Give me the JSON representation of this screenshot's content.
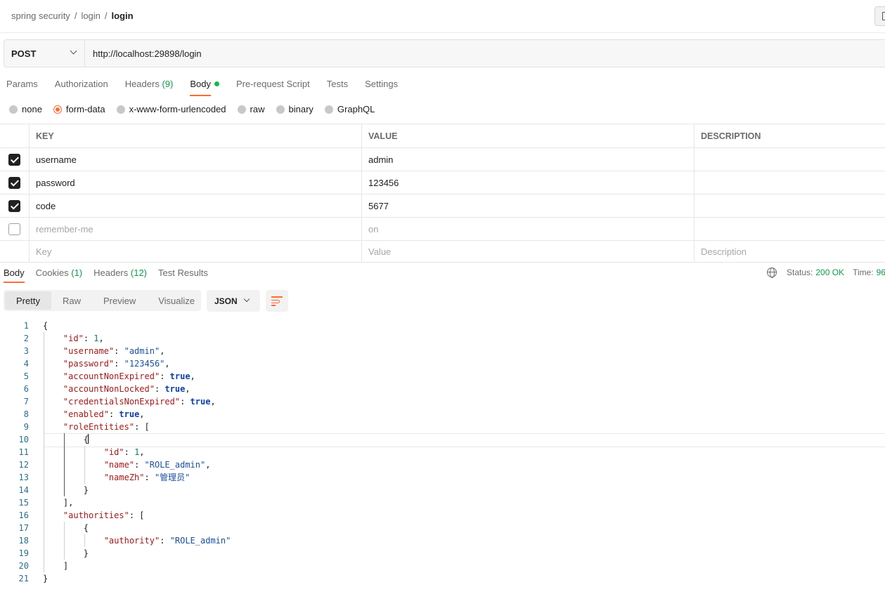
{
  "breadcrumb": {
    "items": [
      "spring security",
      "login"
    ],
    "current": "login"
  },
  "request": {
    "method": "POST",
    "url": "http://localhost:29898/login"
  },
  "request_tabs": [
    {
      "label": "Params"
    },
    {
      "label": "Authorization"
    },
    {
      "label": "Headers",
      "count": "(9)"
    },
    {
      "label": "Body",
      "active": true
    },
    {
      "label": "Pre-request Script"
    },
    {
      "label": "Tests"
    },
    {
      "label": "Settings"
    }
  ],
  "body_types": {
    "options": [
      "none",
      "form-data",
      "x-www-form-urlencoded",
      "raw",
      "binary",
      "GraphQL"
    ],
    "selected": "form-data"
  },
  "params_table": {
    "headers": {
      "key": "KEY",
      "value": "VALUE",
      "description": "DESCRIPTION"
    },
    "rows": [
      {
        "checked": true,
        "key": "username",
        "value": "admin"
      },
      {
        "checked": true,
        "key": "password",
        "value": "123456"
      },
      {
        "checked": true,
        "key": "code",
        "value": "5677"
      },
      {
        "checked": false,
        "key": "remember-me",
        "value": "on"
      }
    ],
    "placeholders": {
      "key": "Key",
      "value": "Value",
      "description": "Description"
    }
  },
  "response_tabs": [
    {
      "label": "Body",
      "active": true
    },
    {
      "label": "Cookies",
      "count": "(1)"
    },
    {
      "label": "Headers",
      "count": "(12)"
    },
    {
      "label": "Test Results"
    }
  ],
  "response_status": {
    "status_label": "Status:",
    "status_value": "200 OK",
    "time_label": "Time:",
    "time_value": "96"
  },
  "view_modes": {
    "options": [
      "Pretty",
      "Raw",
      "Preview",
      "Visualize"
    ],
    "selected": "Pretty"
  },
  "format": "JSON",
  "code_lines": [
    "{",
    "    \"id\": 1,",
    "    \"username\": \"admin\",",
    "    \"password\": \"123456\",",
    "    \"accountNonExpired\": true,",
    "    \"accountNonLocked\": true,",
    "    \"credentialsNonExpired\": true,",
    "    \"enabled\": true,",
    "    \"roleEntities\": [",
    "        {",
    "            \"id\": 1,",
    "            \"name\": \"ROLE_admin\",",
    "            \"nameZh\": \"管理员\"",
    "        }",
    "    ],",
    "    \"authorities\": [",
    "        {",
    "            \"authority\": \"ROLE_admin\"",
    "        }",
    "    ]",
    "}"
  ],
  "cursor_line": 10,
  "colors": {
    "accent": "#ff6c37",
    "success": "#0f9a4a",
    "key": "#a01a1a",
    "string": "#1b4f9a",
    "number": "#0b7a6a",
    "boolean": "#0d3ea8"
  }
}
